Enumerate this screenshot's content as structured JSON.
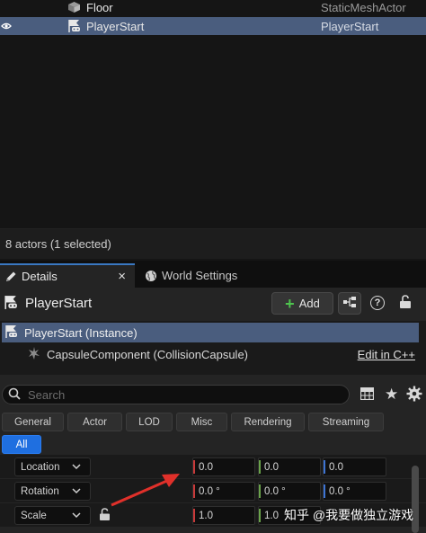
{
  "outliner": {
    "rows": [
      {
        "name": "Floor",
        "type": "StaticMeshActor",
        "icon": "static-mesh-icon",
        "selected": false
      },
      {
        "name": "PlayerStart",
        "type": "PlayerStart",
        "icon": "player-start-icon",
        "selected": true
      }
    ],
    "status": "8 actors (1 selected)"
  },
  "tabs": [
    {
      "label": "Details",
      "icon": "details-pencil-icon",
      "active": true,
      "close": "×"
    },
    {
      "label": "World Settings",
      "icon": "globe-icon",
      "active": false
    }
  ],
  "details": {
    "actor_name": "PlayerStart",
    "add_label": "Add",
    "add_plus": "+",
    "help_glyph": "?",
    "components": {
      "root": "PlayerStart (Instance)",
      "child": "CapsuleComponent (CollisionCapsule)",
      "edit_link": "Edit in C++"
    },
    "search": {
      "placeholder": "Search"
    },
    "filters": [
      "General",
      "Actor",
      "LOD",
      "Misc",
      "Rendering",
      "Streaming"
    ],
    "filter_all": "All",
    "transform": {
      "location": {
        "label": "Location",
        "x": "0.0",
        "y": "0.0",
        "z": "0.0"
      },
      "rotation": {
        "label": "Rotation",
        "x": "0.0 °",
        "y": "0.0 °",
        "z": "0.0 °"
      },
      "scale": {
        "label": "Scale",
        "x": "1.0",
        "y": "1.0"
      }
    }
  },
  "watermark": "知乎 @我要做独立游戏",
  "colors": {
    "accent": "#1f6fe0",
    "selection": "#4a5d7e",
    "arrow": "#e0302a"
  }
}
